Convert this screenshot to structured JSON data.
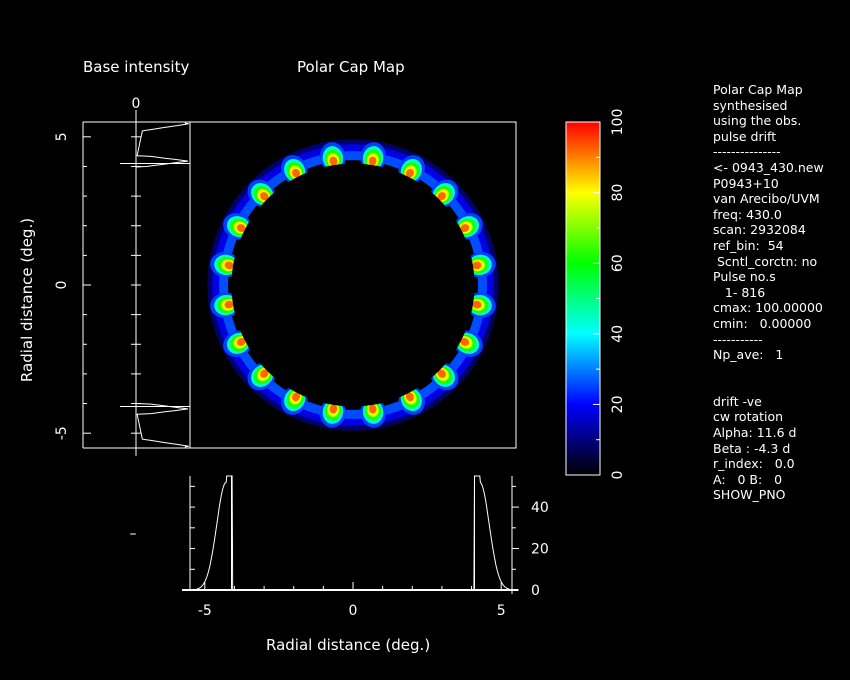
{
  "figure": {
    "left_title": "Base intensity",
    "center_title": "Polar Cap Map",
    "left_top_tick": "0"
  },
  "chart_data": [
    {
      "type": "heatmap",
      "title": "Polar Cap Map",
      "xlabel": "Radial distance (deg.)",
      "ylabel": "Radial distance (deg.)",
      "xlim": [
        -5.5,
        5.5
      ],
      "ylim": [
        -5.5,
        5.5
      ],
      "x_ticks": [
        -5,
        0,
        5
      ],
      "y_ticks": [
        5,
        0,
        -5
      ],
      "ring": {
        "inner_radius": 4.1,
        "peak_radius": 4.3,
        "outer_radius": 4.9,
        "n_subbeams": 20
      },
      "colorbar": {
        "min": 0,
        "max": 100,
        "ticks": [
          0,
          20,
          40,
          60,
          80,
          100
        ],
        "colors": [
          "#000000",
          "#0000ff",
          "#00ffff",
          "#00ff00",
          "#ffff00",
          "#ff0000"
        ]
      }
    },
    {
      "type": "line",
      "title": "Base intensity",
      "note": "left profile",
      "y_ticks": [
        5,
        0,
        -5
      ],
      "top_tick": "0",
      "bottom_tick": "–"
    },
    {
      "type": "line",
      "note": "bottom profile",
      "xlim": [
        -5.5,
        5.5
      ],
      "ylim": [
        0,
        55
      ],
      "x_ticks": [
        -5,
        0,
        5
      ],
      "y_ticks": [
        0,
        20,
        40
      ],
      "peaks_x": [
        -4.1,
        4.1
      ]
    }
  ],
  "side_panel": [
    "Polar Cap Map",
    "synthesised",
    "using the obs.",
    "pulse drift",
    "---------------",
    "<- 0943_430.new",
    "P0943+10",
    "van Arecibo/UVM",
    "freq: 430.0",
    "scan: 2932084",
    "ref_bin:  54",
    " Scntl_corctn: no",
    "Pulse no.s",
    "   1- 816",
    "cmax: 100.00000",
    "cmin:   0.00000",
    "-----------",
    "Np_ave:   1",
    "",
    "",
    "drift -ve",
    "cw rotation",
    "Alpha: 11.6 d",
    "Beta : -4.3 d",
    "r_index:   0.0",
    "A:   0 B:   0",
    "SHOW_PNO"
  ]
}
